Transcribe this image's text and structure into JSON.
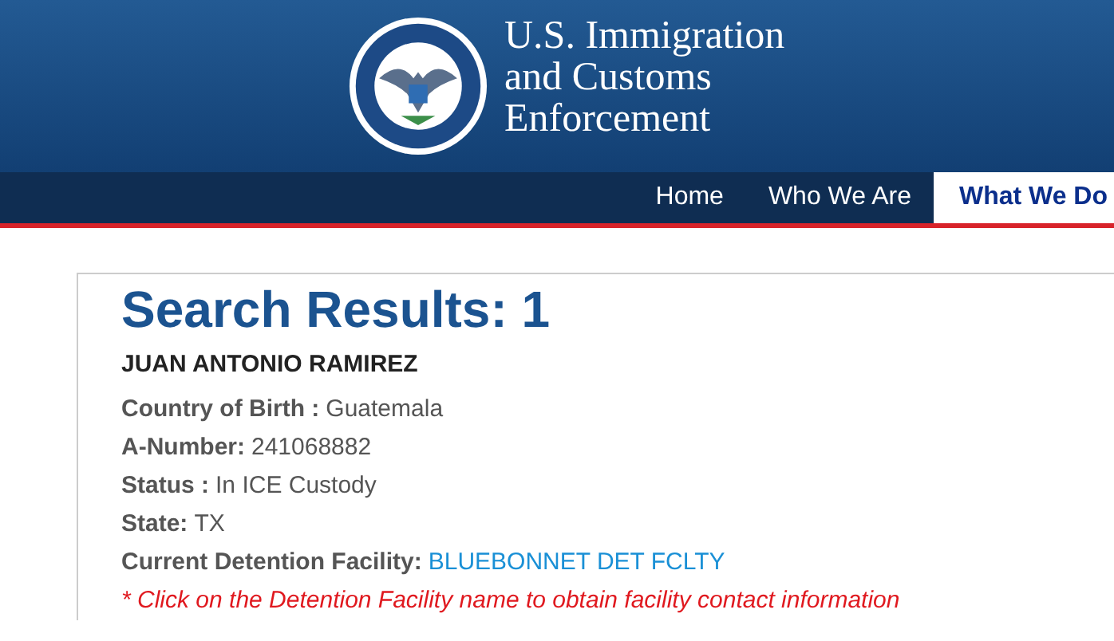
{
  "header": {
    "title_lines": [
      "U.S. Immigration",
      "and Customs",
      "Enforcement"
    ]
  },
  "nav": [
    {
      "label": "Home",
      "selected": false
    },
    {
      "label": "Who We Are",
      "selected": false
    },
    {
      "label": "What We Do",
      "selected": true
    }
  ],
  "results": {
    "heading": "Search Results: 1",
    "name": "JUAN ANTONIO RAMIREZ",
    "fields": [
      {
        "label": "Country of Birth :",
        "value": "Guatemala",
        "kind": "text"
      },
      {
        "label": "A-Number:",
        "value": "241068882",
        "kind": "text"
      },
      {
        "label": "Status :",
        "value": "In ICE Custody",
        "kind": "text"
      },
      {
        "label": "State:",
        "value": "TX",
        "kind": "text"
      },
      {
        "label": "Current Detention Facility:",
        "value": "BLUEBONNET DET FCLTY",
        "kind": "link"
      }
    ],
    "note": "* Click on the Detention Facility name to obtain facility contact information"
  }
}
